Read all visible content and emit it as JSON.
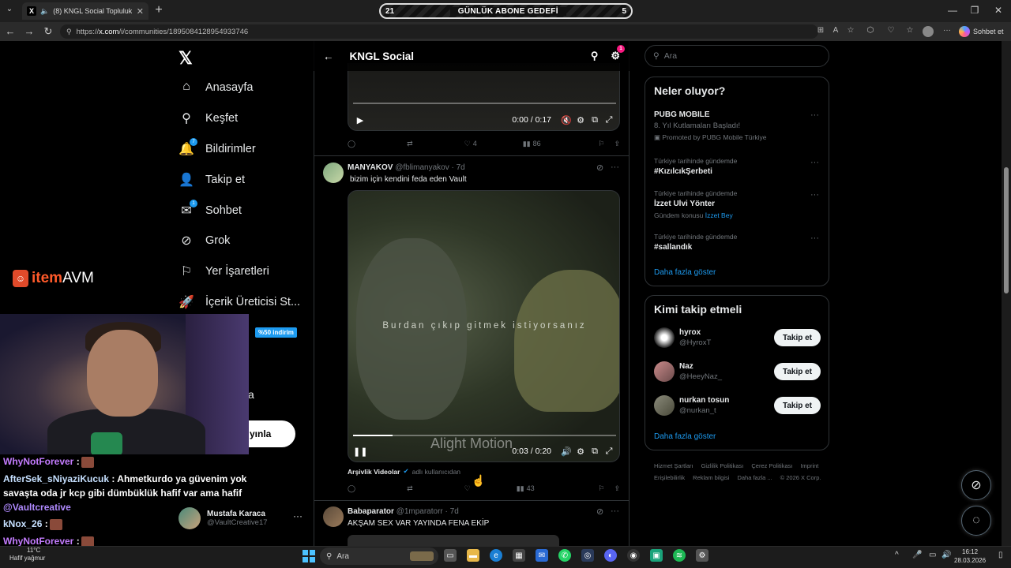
{
  "browser": {
    "tab_title": "(8) KNGL Social Topluluk / X",
    "url_prefix": "https://",
    "url_host": "x.com",
    "url_path": "/i/communities/1895084128954933746",
    "chat_label": "Sohbet et"
  },
  "sub_goal": {
    "left": "21",
    "label": "GÜNLÜK ABONE GEDEFİ",
    "right": "5"
  },
  "sidebar": {
    "items": [
      {
        "label": "Anasayfa",
        "icon": "home-icon"
      },
      {
        "label": "Keşfet",
        "icon": "search-icon"
      },
      {
        "label": "Bildirimler",
        "icon": "bell-icon",
        "badge": "7"
      },
      {
        "label": "Takip et",
        "icon": "add-person-icon"
      },
      {
        "label": "Sohbet",
        "icon": "mail-icon",
        "badge": "1"
      },
      {
        "label": "Grok",
        "icon": "grok-icon"
      },
      {
        "label": "Yer İşaretleri",
        "icon": "bookmark-icon"
      },
      {
        "label": "İçerik Üreticisi St...",
        "icon": "rocket-icon"
      }
    ],
    "partial_more": "a",
    "post_button": "yınla"
  },
  "overlay": {
    "brand_item": "item",
    "brand_avm": "AVM",
    "discount": "%50 indirim",
    "chat": [
      {
        "user": "WhyNotForever",
        "text": ":"
      },
      {
        "user": "AfterSek_sNiyaziKucuk",
        "text": ": Ahmetkurdo ya güvenim yok"
      },
      {
        "user": "",
        "text": "savaşta oda jr kcp gibi dümbüklük hafif var ama hafif"
      },
      {
        "user": "@Vaultcreative",
        "text": ""
      },
      {
        "user": "kNox_26",
        "text": ":"
      },
      {
        "user": "WhyNotForever",
        "text": ":"
      }
    ]
  },
  "account": {
    "name": "Mustafa Karaca",
    "handle": "@VaultCreative17"
  },
  "community": {
    "title": "KNGL Social",
    "settings_badge": "1"
  },
  "posts": [
    {
      "video_time": "0:00 / 0:17",
      "video_progress": 0.0,
      "replies": "",
      "reposts": "",
      "likes": "4",
      "views": "86"
    },
    {
      "author": "MANYAKOV",
      "handle": "@fblimanyakov",
      "age": "· 7d",
      "text": "bizim için kendini feda eden Vault",
      "video_lyric": "Burdan çıkıp gitmek istiyorsanız",
      "video_watermark": "Alight Motion",
      "video_time": "0:03 / 0:20",
      "video_progress": 0.15,
      "source_name": "Arşivlik Videolar",
      "source_note": "adlı kullanıcıdan",
      "views": "43"
    },
    {
      "author": "Babaparator",
      "handle": "@1mparatorr",
      "age": "· 7d",
      "text": "AKŞAM SEX VAR YAYINDA FENA EKİP"
    }
  ],
  "right": {
    "search_placeholder": "Ara",
    "trends_title": "Neler oluyor?",
    "trends": [
      {
        "name": "PUBG MOBILE",
        "sub": "8. Yıl Kutlamaları Başladı!",
        "promo": "Promoted by PUBG Mobile Türkiye"
      },
      {
        "ctx": "Türkiye tarihinde gündemde",
        "name": "#KızılcıkŞerbeti"
      },
      {
        "ctx": "Türkiye tarihinde gündemde",
        "name": "İzzet Ulvi Yönter",
        "sub": "Gündem konusu",
        "sub_link": "İzzet Bey"
      },
      {
        "ctx": "Türkiye tarihinde gündemde",
        "name": "#sallandık"
      }
    ],
    "show_more": "Daha fazla göster",
    "follow_title": "Kimi takip etmeli",
    "follow": [
      {
        "name": "hyrox",
        "handle": "@HyroxT",
        "button": "Takip et"
      },
      {
        "name": "Naz",
        "handle": "@HeeyNaz_",
        "button": "Takip et"
      },
      {
        "name": "nurkan tosun",
        "handle": "@nurkan_t",
        "button": "Takip et"
      }
    ],
    "footer": [
      "Hizmet Şartları",
      "Gizlilik Politikası",
      "Çerez Politikası",
      "Imprint",
      "Erişilebilirlik",
      "Reklam bilgisi",
      "Daha fazla ...",
      "© 2026 X Corp."
    ]
  },
  "taskbar": {
    "temp": "11°C",
    "weather": "Hafif yağmur",
    "search": "Ara",
    "time": "16:12",
    "date": "28.03.2026"
  },
  "colors": {
    "accent": "#1d9bf0",
    "background": "#000000",
    "border": "#2f3336",
    "muted": "#71767b"
  }
}
